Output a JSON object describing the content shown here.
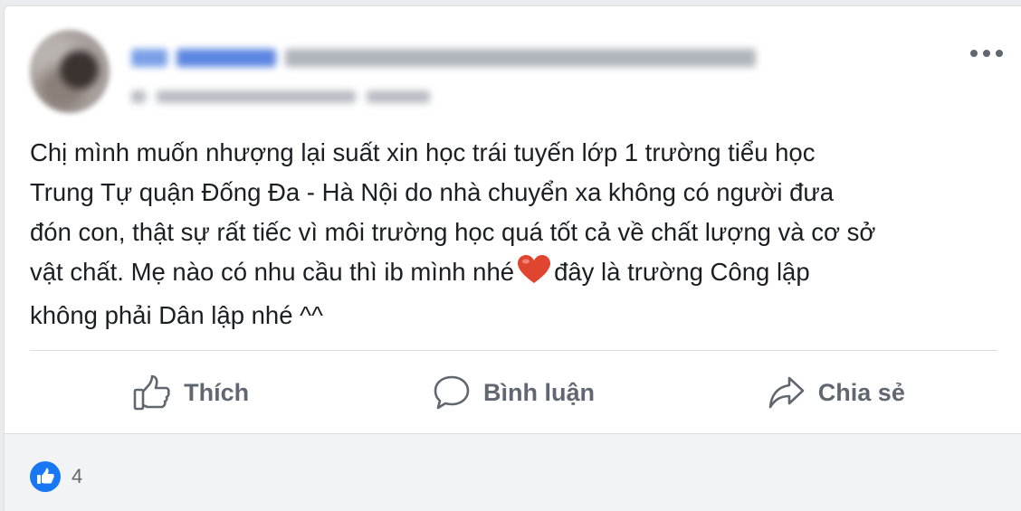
{
  "post": {
    "lines": [
      "Chị mình muốn nhượng lại suất xin học trái tuyến lớp 1 trường tiểu học",
      "Trung Tự quận Đống Đa - Hà Nội do nhà chuyển xa không có người đưa",
      "đón con, thật sự rất tiếc vì môi trường học quá tốt cả về chất lượng và cơ sở",
      "vật chất. Mẹ nào có nhu cầu thì ib mình nhé",
      "không phải Dân lập nhé ^^"
    ],
    "line4_after_heart": "đây là trường Công lập"
  },
  "actions": {
    "like": "Thích",
    "comment": "Bình luận",
    "share": "Chia sẻ"
  },
  "reactions": {
    "count": "4"
  },
  "colors": {
    "heart": "#e0452f",
    "like_blue": "#1877f2",
    "action_gray": "#606770"
  }
}
